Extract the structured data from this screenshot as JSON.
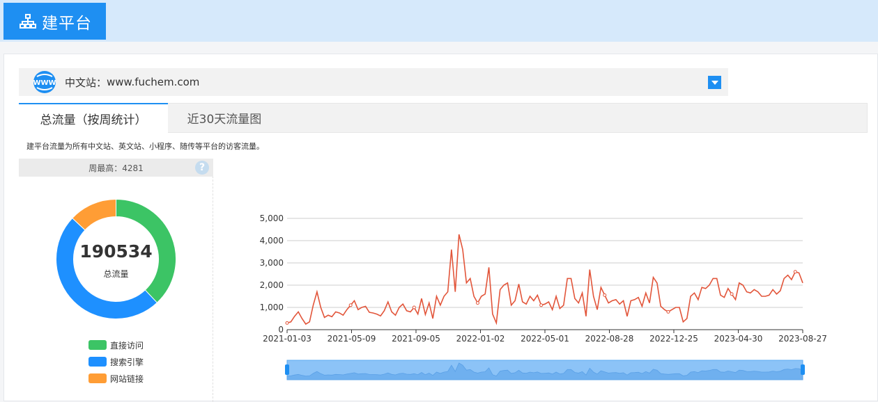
{
  "brand": {
    "title": "建平台"
  },
  "site_select": {
    "label": "中文站：",
    "url": "www.fuchem.com"
  },
  "tabs": [
    {
      "label": "总流量（按周统计）"
    },
    {
      "label": "近30天流量图"
    }
  ],
  "description": "建平台流量为所有中文站、英文站、小程序、随传等平台的访客流量。",
  "peak": {
    "text": "周最高：4281"
  },
  "donut": {
    "total": "190534",
    "subtitle": "总流量",
    "segments": [
      {
        "name": "直接访问",
        "color": "#3cc465",
        "share": 0.38
      },
      {
        "name": "搜索引擎",
        "color": "#1e90ff",
        "share": 0.49
      },
      {
        "name": "网站链接",
        "color": "#ff9d35",
        "share": 0.13
      }
    ]
  },
  "colors": {
    "accent": "#1e8ff2",
    "line": "#e2553a",
    "slider": "#8cc3f7"
  },
  "chart_data": {
    "type": "line",
    "x_ticks": [
      "2021-01-03",
      "2021-05-09",
      "2021-09-05",
      "2022-01-02",
      "2022-05-01",
      "2022-08-28",
      "2022-12-25",
      "2023-04-30",
      "2023-08-27"
    ],
    "y_ticks": [
      "0",
      "1,000",
      "2,000",
      "3,000",
      "4,000",
      "5,000"
    ],
    "ylim": [
      0,
      5000
    ],
    "grid": true,
    "series": [
      {
        "values": [
          300,
          350,
          600,
          800,
          500,
          250,
          350,
          1100,
          1700,
          1000,
          550,
          650,
          580,
          800,
          750,
          650,
          900,
          1100,
          1300,
          900,
          1000,
          1050,
          780,
          750,
          700,
          620,
          850,
          1250,
          800,
          650,
          1000,
          1150,
          850,
          800,
          1000,
          700,
          1400,
          680,
          1200,
          500,
          1500,
          1100,
          1500,
          1700,
          3600,
          1700,
          4281,
          3600,
          2100,
          2300,
          1500,
          1200,
          1500,
          1600,
          2800,
          700,
          300,
          1800,
          2000,
          2100,
          1100,
          1300,
          2050,
          1250,
          1150,
          1500,
          1300,
          1550,
          1100,
          1150,
          1250,
          900,
          1500,
          950,
          1100,
          2300,
          2300,
          1400,
          1200,
          1650,
          600,
          2700,
          1500,
          900,
          1900,
          1550,
          1200,
          1300,
          1350,
          1150,
          1300,
          600,
          1300,
          1350,
          1450,
          1050,
          1650,
          1200,
          2350,
          2100,
          1050,
          900,
          800,
          900,
          1000,
          1000,
          350,
          500,
          1500,
          1650,
          1350,
          1900,
          1850,
          2000,
          2300,
          2300,
          1550,
          1450,
          1850,
          1600,
          1350,
          2100,
          2000,
          1700,
          1650,
          1800,
          1700,
          1500,
          1500,
          1550,
          1800,
          1600,
          1750,
          2300,
          2450,
          2250,
          2600,
          2550,
          2100
        ]
      }
    ]
  }
}
